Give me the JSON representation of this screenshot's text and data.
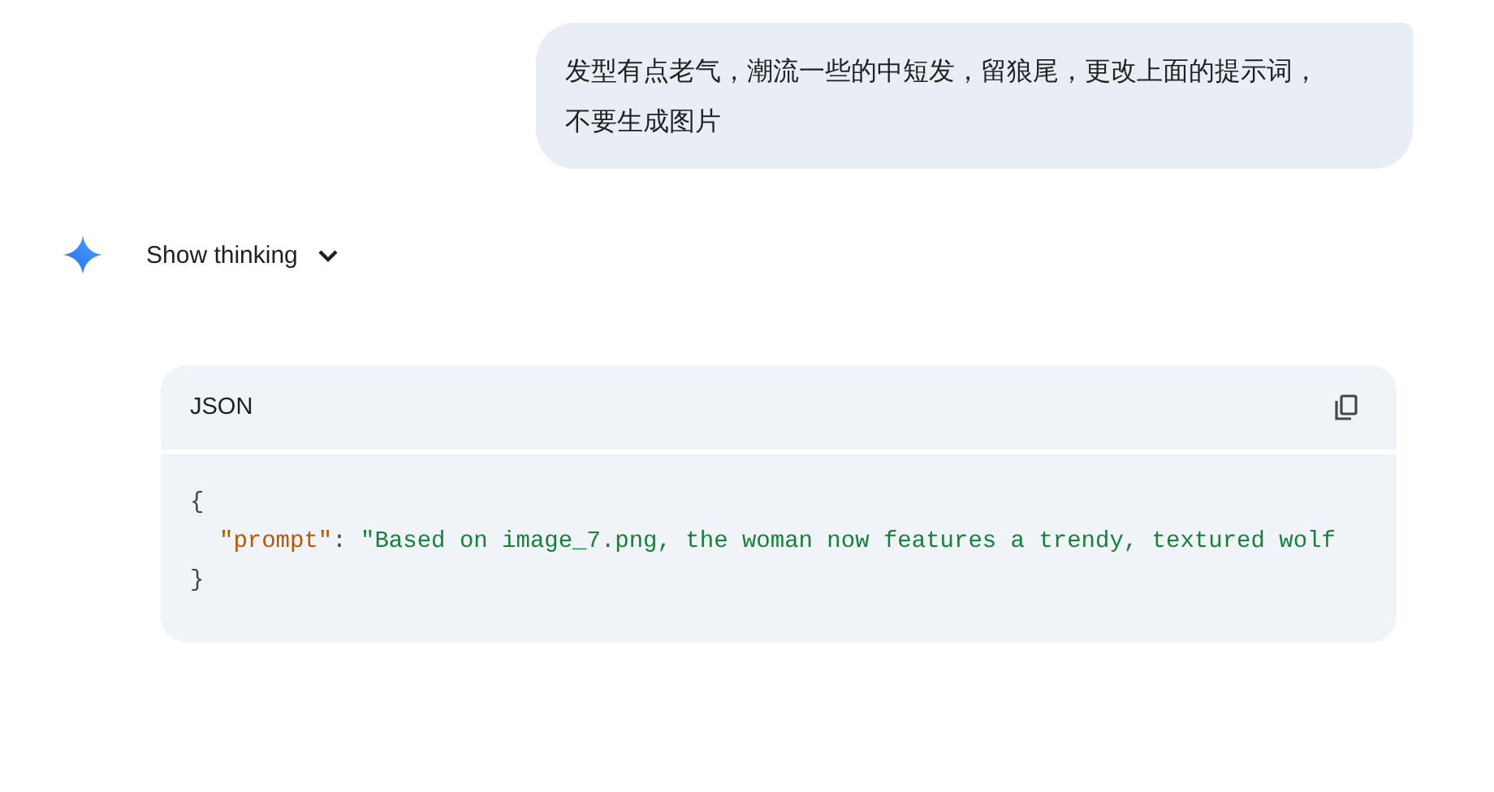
{
  "user_message": {
    "text": "发型有点老气，潮流一些的中短发，留狼尾，更改上面的提示词，不要生成图片"
  },
  "response": {
    "thinking_toggle": {
      "label": "Show thinking",
      "expanded": false
    },
    "code_block": {
      "language": "JSON",
      "lines": [
        {
          "indented": false,
          "tokens": [
            {
              "kind": "punct",
              "text": "{"
            }
          ]
        },
        {
          "indented": true,
          "tokens": [
            {
              "kind": "key",
              "text": "\"prompt\""
            },
            {
              "kind": "punct",
              "text": ": "
            },
            {
              "kind": "string",
              "text": "\"Based on image_7.png, the woman now features a trendy, textured wolf"
            }
          ]
        },
        {
          "indented": false,
          "tokens": [
            {
              "kind": "punct",
              "text": "}"
            }
          ]
        }
      ]
    }
  }
}
